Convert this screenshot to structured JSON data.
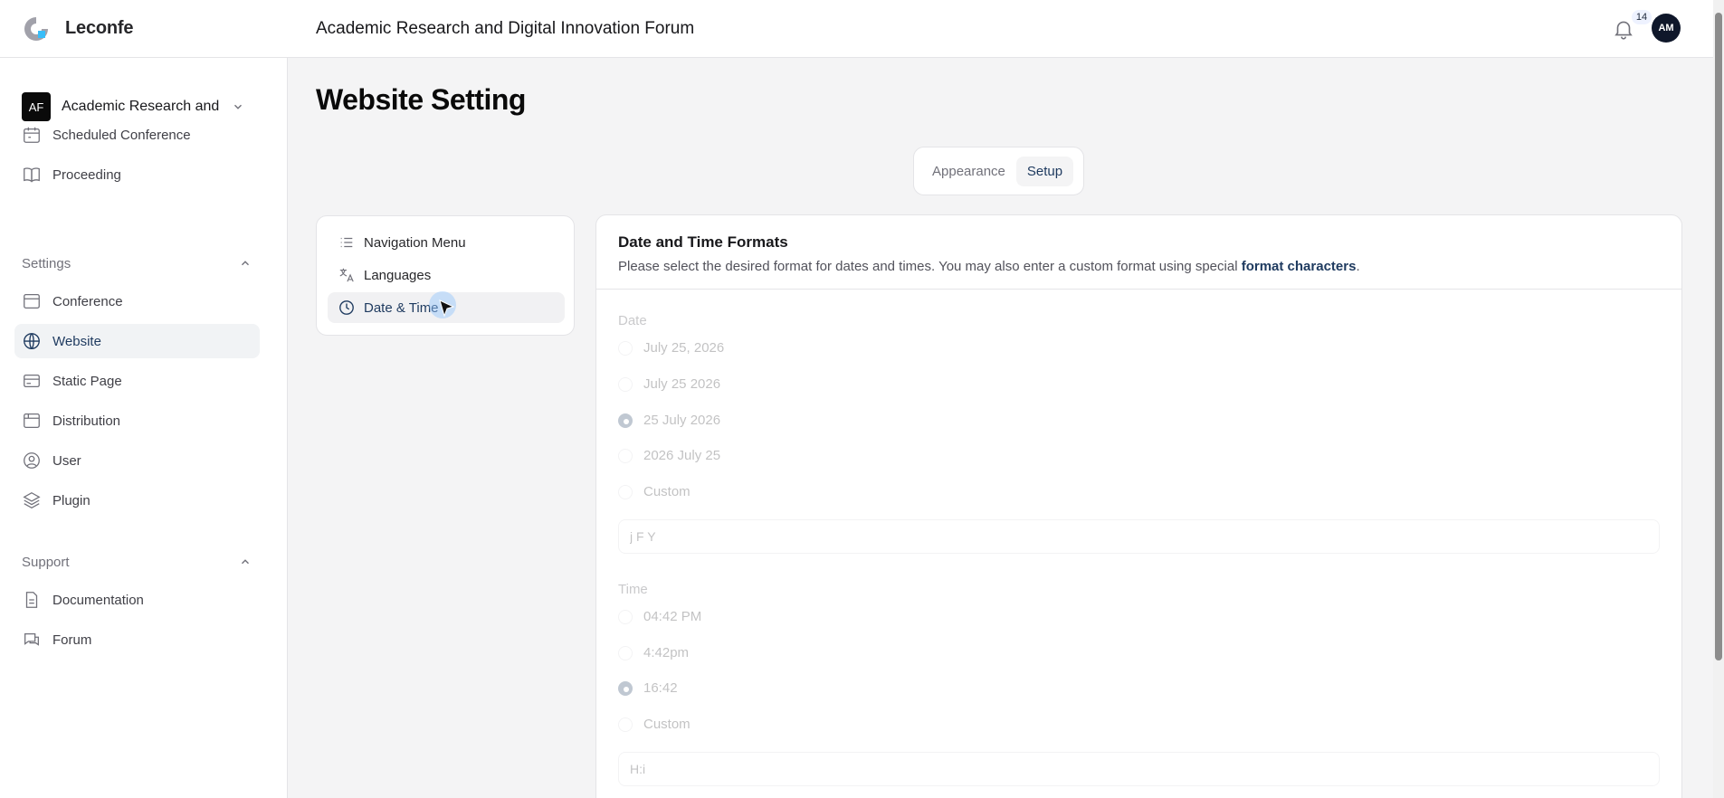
{
  "app": {
    "brand": "Leconfe",
    "title": "Academic Research and Digital Innovation Forum"
  },
  "header": {
    "notification_count": "14",
    "avatar_initials": "AM"
  },
  "sidebar": {
    "org": {
      "badge": "AF",
      "name": "Academic Research and Digital Innovation Forum"
    },
    "top_items": [
      {
        "label": "Scheduled Conference",
        "icon": "calendar-icon"
      },
      {
        "label": "Proceeding",
        "icon": "book-open-icon"
      }
    ],
    "settings_label": "Settings",
    "settings_items": [
      {
        "label": "Conference",
        "icon": "window-icon"
      },
      {
        "label": "Website",
        "icon": "globe-icon",
        "active": true
      },
      {
        "label": "Static Page",
        "icon": "card-icon"
      },
      {
        "label": "Distribution",
        "icon": "browser-icon"
      },
      {
        "label": "User",
        "icon": "user-circle-icon"
      },
      {
        "label": "Plugin",
        "icon": "layers-icon"
      }
    ],
    "support_label": "Support",
    "support_items": [
      {
        "label": "Documentation",
        "icon": "document-icon"
      },
      {
        "label": "Forum",
        "icon": "chat-icon"
      }
    ]
  },
  "main": {
    "page_title": "Website Setting",
    "tabs": [
      {
        "label": "Appearance",
        "active": false
      },
      {
        "label": "Setup",
        "active": true
      }
    ],
    "subnav": [
      {
        "label": "Navigation Menu",
        "icon": "list-icon"
      },
      {
        "label": "Languages",
        "icon": "translate-icon"
      },
      {
        "label": "Date & Time",
        "icon": "clock-icon",
        "active": true
      }
    ],
    "panel": {
      "title": "Date and Time Formats",
      "description": "Please select the desired format for dates and times. You may also enter a custom format using special ",
      "description_link": "format characters",
      "description_end": ".",
      "date_label": "Date",
      "date_options": [
        "July 25, 2026",
        "July 25 2026",
        "25 July 2026",
        "2026 July 25",
        "Custom"
      ],
      "date_selected": "25 July 2026",
      "date_custom_value": "j F Y",
      "time_label": "Time",
      "time_options": [
        "04:42 PM",
        "4:42pm",
        "16:42",
        "Custom"
      ],
      "time_selected": "16:42",
      "time_custom_value": "H:i"
    }
  },
  "colors": {
    "accent": "#1e3a5f",
    "active_bg": "#f1f3f5",
    "border": "#e4e4e7"
  }
}
